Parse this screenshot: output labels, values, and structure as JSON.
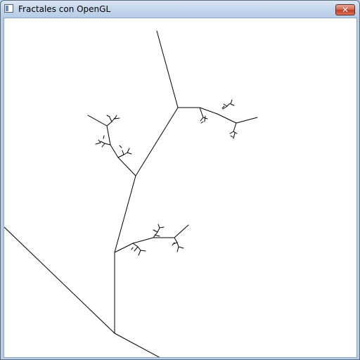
{
  "window": {
    "title": "Fractales con OpenGL",
    "icon": "window-app-icon",
    "close_icon": "close-icon",
    "close_glyph": "✕"
  },
  "canvas": {
    "background": "#ffffff",
    "stroke": "#000000",
    "content": "fractal-tree-drawing"
  }
}
